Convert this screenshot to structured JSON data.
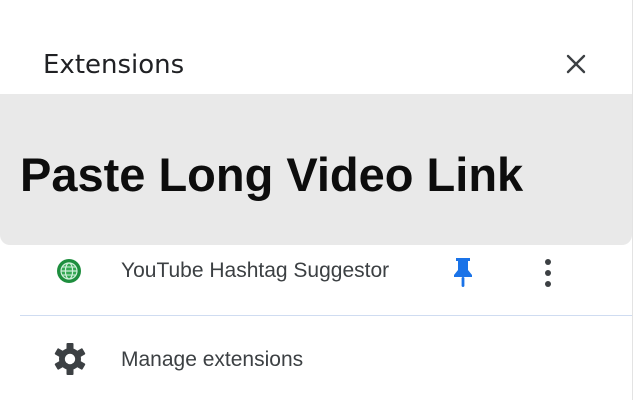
{
  "panel": {
    "title": "Extensions",
    "close_icon": "close-icon"
  },
  "overlay": {
    "text": "Paste Long Video Link"
  },
  "extensions": [
    {
      "name": "YouTube Hashtag Suggestor",
      "icon": "extension-green-globe-icon",
      "pinned": true,
      "pin_color": "#1a73e8",
      "icon_color": "#1e8e3e"
    }
  ],
  "footer": {
    "manage_label": "Manage extensions",
    "manage_icon": "gear-icon"
  }
}
